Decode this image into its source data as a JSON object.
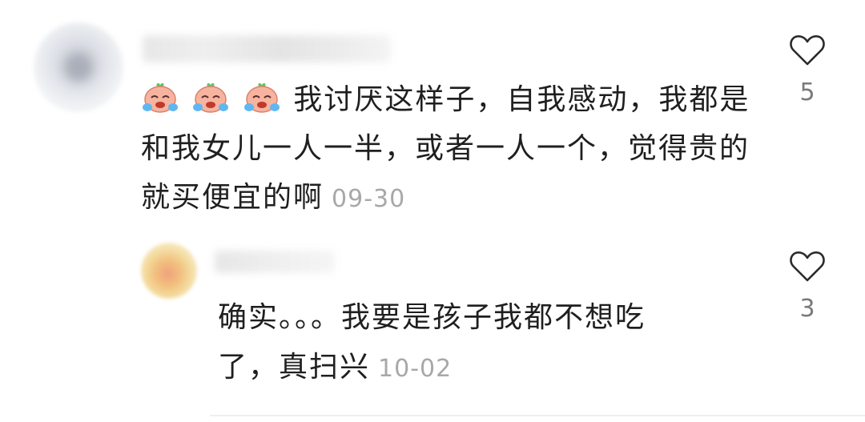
{
  "comments": [
    {
      "emoji_count": 3,
      "emoji_icon": "crying-face-sticker-icon",
      "text": "我讨厌这样子，自我感动，我都是和我女儿一人一半，或者一人一个，觉得贵的就买便宜的啊",
      "date": "09-30",
      "likes": "5",
      "like_icon": "heart-outline-icon"
    }
  ],
  "replies": [
    {
      "text": "确实。。。我要是孩子我都不想吃了，真扫兴",
      "date": "10-02",
      "likes": "3",
      "like_icon": "heart-outline-icon"
    }
  ],
  "colors": {
    "text": "#1f1f1f",
    "meta": "#a8a8a8",
    "like_count": "#7a7a7a",
    "heart_stroke": "#2b2b2b"
  }
}
